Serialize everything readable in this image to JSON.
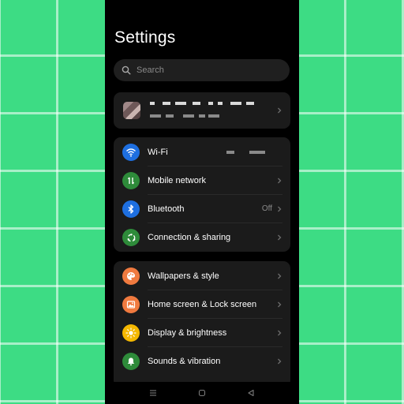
{
  "header": {
    "title": "Settings"
  },
  "search": {
    "placeholder": "Search"
  },
  "account": {
    "chevron": "chevron-right-icon"
  },
  "connectivity": [
    {
      "label": "Wi-Fi",
      "value": "",
      "icon": "wifi-icon",
      "color": "#1e6fe0"
    },
    {
      "label": "Mobile network",
      "value": "",
      "icon": "mobile-data-icon",
      "color": "#2e8b3a"
    },
    {
      "label": "Bluetooth",
      "value": "Off",
      "icon": "bluetooth-icon",
      "color": "#1e6fe0"
    },
    {
      "label": "Connection & sharing",
      "value": "",
      "icon": "connection-sharing-icon",
      "color": "#2e8b3a"
    }
  ],
  "personalization": [
    {
      "label": "Wallpapers & style",
      "icon": "palette-icon",
      "color": "#f07a3f"
    },
    {
      "label": "Home screen & Lock screen",
      "icon": "image-icon",
      "color": "#f07a3f"
    },
    {
      "label": "Display & brightness",
      "icon": "sun-icon",
      "color": "#f5b800"
    },
    {
      "label": "Sounds & vibration",
      "icon": "bell-icon",
      "color": "#2e8b3a"
    }
  ],
  "nav": [
    "menu-icon",
    "home-icon",
    "back-icon"
  ]
}
